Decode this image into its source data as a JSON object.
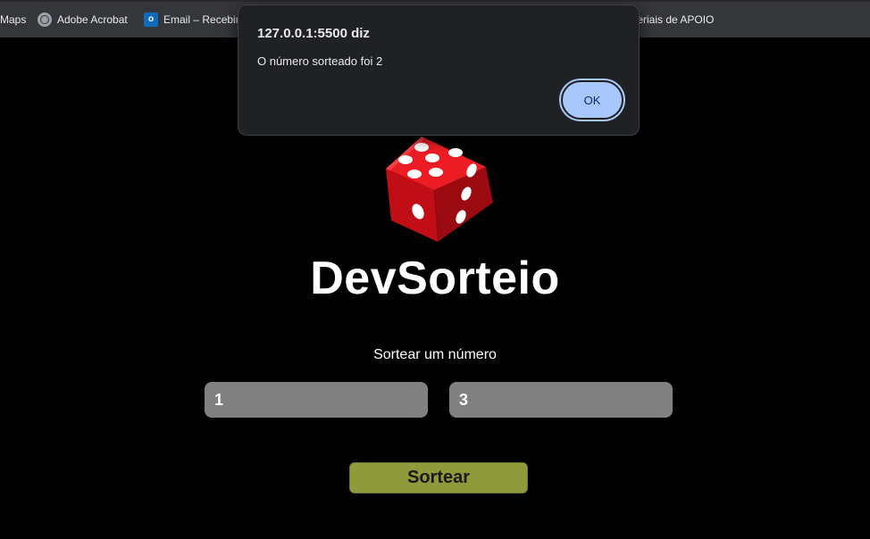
{
  "bookmarks": [
    {
      "label": "Maps",
      "icon": "maps"
    },
    {
      "label": "Adobe Acrobat",
      "icon": "globe-icon"
    },
    {
      "label": "Email – Recebim",
      "icon": "outlook-icon"
    },
    {
      "label": "teriais de APOIO",
      "icon": "none"
    }
  ],
  "app": {
    "title": "DevSorteio",
    "subtitle": "Sortear um número",
    "min_value": "1",
    "max_value": "3",
    "button_label": "Sortear"
  },
  "dialog": {
    "origin": "127.0.0.1:5500 diz",
    "message": "O número sorteado foi 2",
    "ok_label": "OK"
  },
  "colors": {
    "background": "#000000",
    "input_bg": "#808080",
    "button_bg": "#8f9a3a",
    "dice_red": "#d9121b",
    "dialog_bg": "#202124",
    "ok_bg": "#a8c7fa"
  }
}
